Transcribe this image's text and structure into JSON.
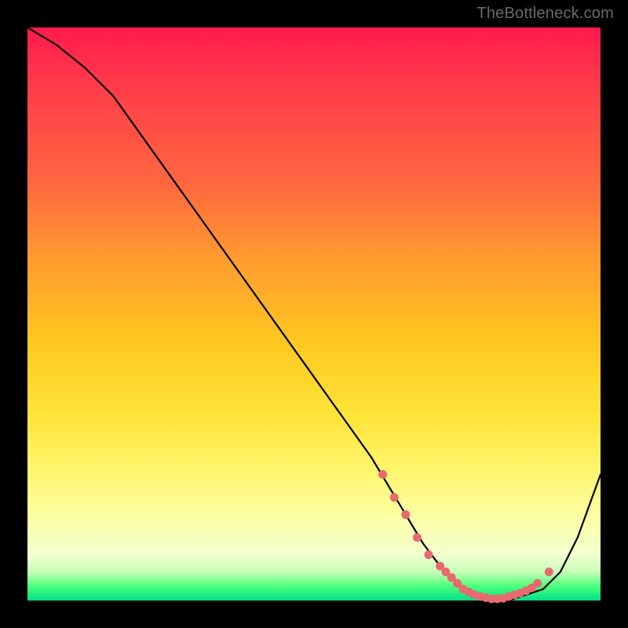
{
  "watermark": "TheBottleneck.com",
  "colors": {
    "background": "#000000",
    "gradient_top": "#ff1a4d",
    "gradient_mid": "#ffe53a",
    "gradient_bottom": "#00e08a",
    "curve": "#000000",
    "markers": "#e86a6e"
  },
  "chart_data": {
    "type": "line",
    "title": "",
    "xlabel": "",
    "ylabel": "",
    "xlim": [
      0,
      100
    ],
    "ylim": [
      0,
      100
    ],
    "grid": false,
    "legend": false,
    "series": [
      {
        "name": "curve",
        "x": [
          0,
          5,
          10,
          15,
          20,
          25,
          30,
          35,
          40,
          45,
          50,
          55,
          60,
          63,
          66,
          69,
          72,
          75,
          78,
          81,
          84,
          87,
          90,
          93,
          96,
          100
        ],
        "values": [
          100,
          97,
          93,
          88,
          81,
          74,
          67,
          60,
          53,
          46,
          39,
          32,
          25,
          20,
          15,
          10,
          6,
          3,
          1,
          0,
          0,
          1,
          2,
          5,
          11,
          22
        ]
      }
    ],
    "markers": {
      "name": "highlighted-points",
      "x": [
        62,
        64,
        66,
        68,
        70,
        72,
        73,
        74,
        75,
        76,
        77,
        78,
        79,
        80,
        81,
        82,
        83,
        84,
        85,
        86,
        87,
        88,
        89,
        91
      ],
      "values": [
        22,
        18,
        15,
        11,
        8,
        6,
        5,
        4,
        3,
        2,
        1.5,
        1,
        0.7,
        0.5,
        0.3,
        0.3,
        0.4,
        0.7,
        1,
        1.3,
        1.7,
        2.2,
        3.0,
        5.0
      ]
    }
  }
}
